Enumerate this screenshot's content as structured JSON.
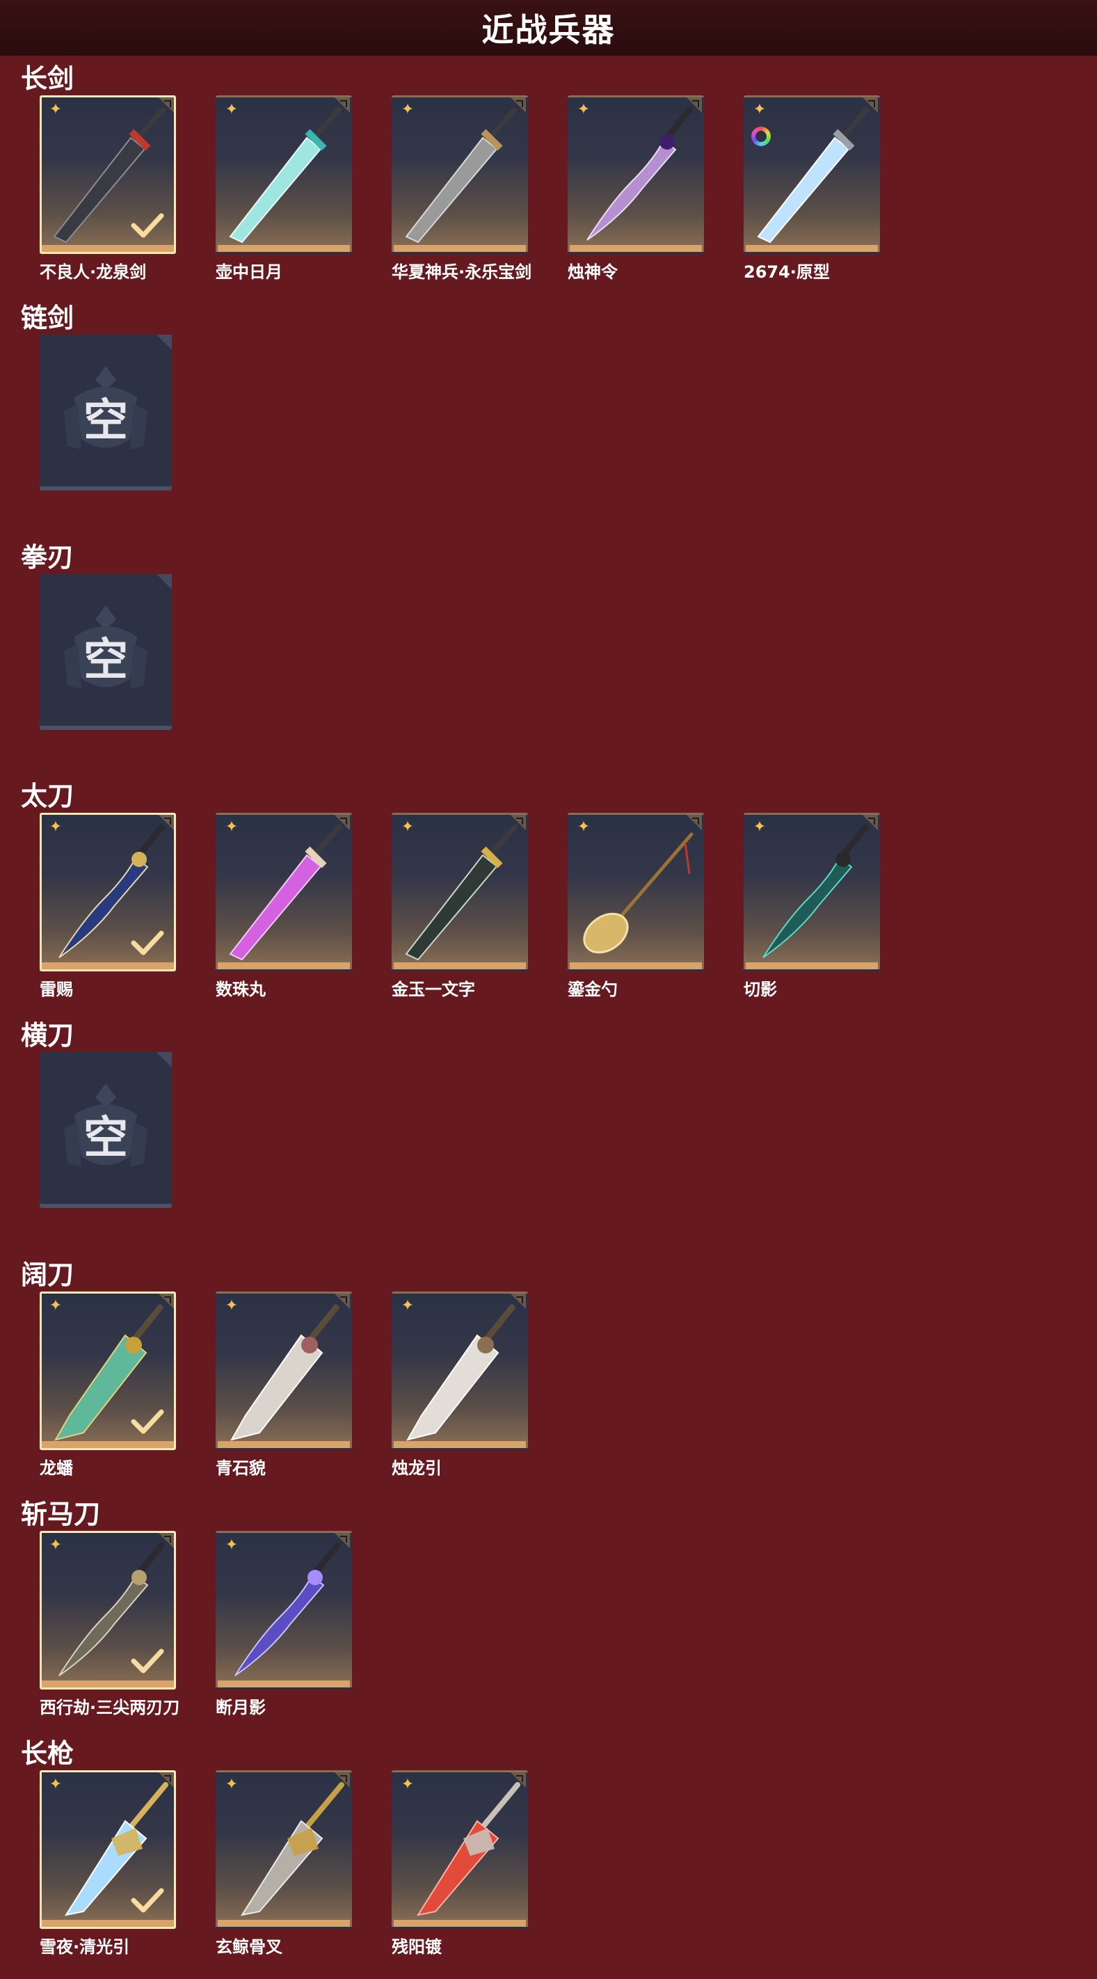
{
  "header": {
    "title": "近战兵器"
  },
  "colors": {
    "background": "#661a1f",
    "selected_border": "#fbe9b6",
    "star": "#f4c152",
    "card_bottom": "#d9a36a",
    "empty_card": "#2c3244"
  },
  "empty_label": "空",
  "categories": [
    {
      "title": "长剑",
      "items": [
        {
          "name": "不良人·龙泉剑",
          "selected": true,
          "icon": "sword-dark-red-icon"
        },
        {
          "name": "壶中日月",
          "selected": false,
          "icon": "sword-teal-icon"
        },
        {
          "name": "华夏神兵·永乐宝剑",
          "selected": false,
          "icon": "sword-steel-icon"
        },
        {
          "name": "烛神令",
          "selected": false,
          "icon": "sword-purple-curved-icon"
        },
        {
          "name": "2674·原型",
          "selected": false,
          "icon": "sword-glowing-blue-icon",
          "rainbow_badge": true
        }
      ]
    },
    {
      "title": "链剑",
      "items": []
    },
    {
      "title": "拳刃",
      "items": []
    },
    {
      "title": "太刀",
      "items": [
        {
          "name": "雷赐",
          "selected": true,
          "icon": "katana-blue-gold-icon"
        },
        {
          "name": "数珠丸",
          "selected": false,
          "icon": "katana-pink-icon"
        },
        {
          "name": "金玉一文字",
          "selected": false,
          "icon": "katana-gold-jade-icon"
        },
        {
          "name": "鎏金勺",
          "selected": false,
          "icon": "golden-spoon-icon"
        },
        {
          "name": "切影",
          "selected": false,
          "icon": "katana-green-dark-icon"
        }
      ]
    },
    {
      "title": "横刀",
      "items": []
    },
    {
      "title": "阔刀",
      "items": [
        {
          "name": "龙蟠",
          "selected": true,
          "icon": "broadsword-jade-gold-icon"
        },
        {
          "name": "青石貌",
          "selected": false,
          "icon": "broadsword-white-icon"
        },
        {
          "name": "烛龙引",
          "selected": false,
          "icon": "broadsword-white-dragon-icon"
        }
      ]
    },
    {
      "title": "斩马刀",
      "items": [
        {
          "name": "西行劫·三尖两刃刀",
          "selected": true,
          "icon": "halberd-bronze-icon"
        },
        {
          "name": "断月影",
          "selected": false,
          "icon": "halberd-purple-icon"
        }
      ]
    },
    {
      "title": "长枪",
      "items": [
        {
          "name": "雪夜·清光引",
          "selected": true,
          "icon": "spear-ice-icon"
        },
        {
          "name": "玄鲸骨叉",
          "selected": false,
          "icon": "trident-bone-icon"
        },
        {
          "name": "残阳镀",
          "selected": false,
          "icon": "spear-red-icon"
        }
      ]
    }
  ]
}
